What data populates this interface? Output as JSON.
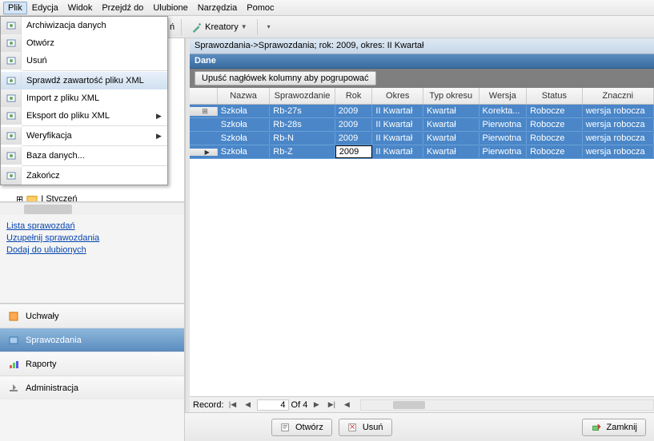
{
  "menubar": [
    "Plik",
    "Edycja",
    "Widok",
    "Przejdź do",
    "Ulubione",
    "Narzędzia",
    "Pomoc"
  ],
  "toolbar": {
    "usun": "ń",
    "kreatory": "Kreatory"
  },
  "plik_menu": [
    {
      "label": "Archiwizacja danych",
      "icon": "archive-icon"
    },
    {
      "label": "Otwórz",
      "icon": "open-icon"
    },
    {
      "label": "Usuń",
      "icon": "delete-icon"
    },
    {
      "sep": true
    },
    {
      "label": "Sprawdź zawartość pliku XML",
      "icon": "check-icon",
      "hl": true
    },
    {
      "label": "Import z pliku XML",
      "icon": "import-icon"
    },
    {
      "label": "Eksport do pliku XML",
      "icon": "export-icon",
      "sub": true
    },
    {
      "sep": true
    },
    {
      "label": "Weryfikacja",
      "icon": "verify-icon",
      "sub": true
    },
    {
      "sep": true
    },
    {
      "label": "Baza danych...",
      "icon": "db-icon"
    },
    {
      "sep": true
    },
    {
      "label": "Zakończ",
      "icon": "exit-icon"
    }
  ],
  "tree_item": "I Styczeń",
  "links": [
    "Lista sprawozdań",
    "Uzupełnij sprawozdania",
    "Dodaj do ulubionych"
  ],
  "nav": [
    {
      "label": "Uchwały",
      "sel": false
    },
    {
      "label": "Sprawozdania",
      "sel": true
    },
    {
      "label": "Raporty",
      "sel": false
    },
    {
      "label": "Administracja",
      "sel": false
    }
  ],
  "breadcrumb": "Sprawozdania->Sprawozdania; rok: 2009, okres: II Kwartał",
  "section": "Dane",
  "group_hint": "Upuść nagłówek kolumny aby pogrupować",
  "columns": [
    "",
    "Nazwa",
    "Sprawozdanie",
    "Rok",
    "Okres",
    "Typ okresu",
    "Wersja",
    "Status",
    "Znaczni"
  ],
  "rows": [
    {
      "nazwa": "Szkoła",
      "spr": "Rb-27s",
      "rok": "2009",
      "okres": "II Kwartał",
      "typ": "Kwartał",
      "wer": "Korekta...",
      "sta": "Robocze",
      "zna": "wersja robocza"
    },
    {
      "nazwa": "Szkoła",
      "spr": "Rb-28s",
      "rok": "2009",
      "okres": "II Kwartał",
      "typ": "Kwartał",
      "wer": "Pierwotna",
      "sta": "Robocze",
      "zna": "wersja robocza"
    },
    {
      "nazwa": "Szkoła",
      "spr": "Rb-N",
      "rok": "2009",
      "okres": "II Kwartał",
      "typ": "Kwartał",
      "wer": "Pierwotna",
      "sta": "Robocze",
      "zna": "wersja robocza"
    },
    {
      "nazwa": "Szkoła",
      "spr": "Rb-Z",
      "rok": "2009",
      "okres": "II Kwartał",
      "typ": "Kwartał",
      "wer": "Pierwotna",
      "sta": "Robocze",
      "zna": "wersja robocza",
      "active": true
    }
  ],
  "record": {
    "label": "Record:",
    "cur": "4",
    "of": "Of  4"
  },
  "buttons": {
    "otworz": "Otwórz",
    "usun": "Usuń",
    "zamknij": "Zamknij"
  }
}
